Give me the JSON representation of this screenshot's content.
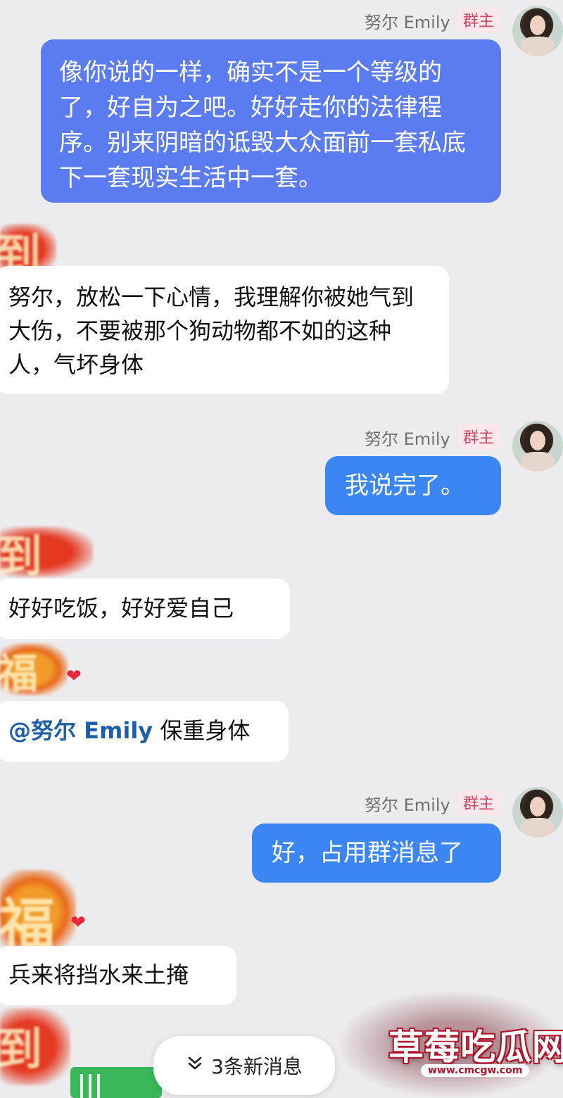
{
  "sender_name": "努尔 Emily",
  "owner_badge": "群主",
  "colors": {
    "self_bubble_blue": "#5b7bf1",
    "self_bubble_blue_alt": "#3c86f4",
    "other_bubble": "#ffffff",
    "background": "#ececee",
    "badge_text": "#c94a63",
    "mention_text": "#1f5fa8"
  },
  "messages": [
    {
      "side": "self",
      "text": "像你说的一样，确实不是一个等级的了，好自为之吧。好好走你的法律程序。别来阴暗的诋毁大众面前一套私底下一套现实生活中一套。"
    },
    {
      "side": "other",
      "text": "努尔，放松一下心情，我理解你被她气到大伤，不要被那个狗动物都不如的这种人，气坏身体"
    },
    {
      "side": "self",
      "text": "我说完了。"
    },
    {
      "side": "other",
      "text": "好好吃饭，好好爱自己"
    },
    {
      "side": "other",
      "mention": "@努尔 Emily",
      "text": " 保重身体"
    },
    {
      "side": "self",
      "text": "好，占用群消息了"
    },
    {
      "side": "other",
      "text": "兵来将挡水来土掩"
    }
  ],
  "new_messages": {
    "icon": "chevron-double-down-icon",
    "label": "3条新消息"
  },
  "watermark": {
    "title": "草莓吃瓜网",
    "url": "www.cmcgw.com"
  },
  "stickers": [
    {
      "name": "red-sticker",
      "glyph": "到"
    },
    {
      "name": "fu-sticker",
      "glyph": "福"
    }
  ]
}
